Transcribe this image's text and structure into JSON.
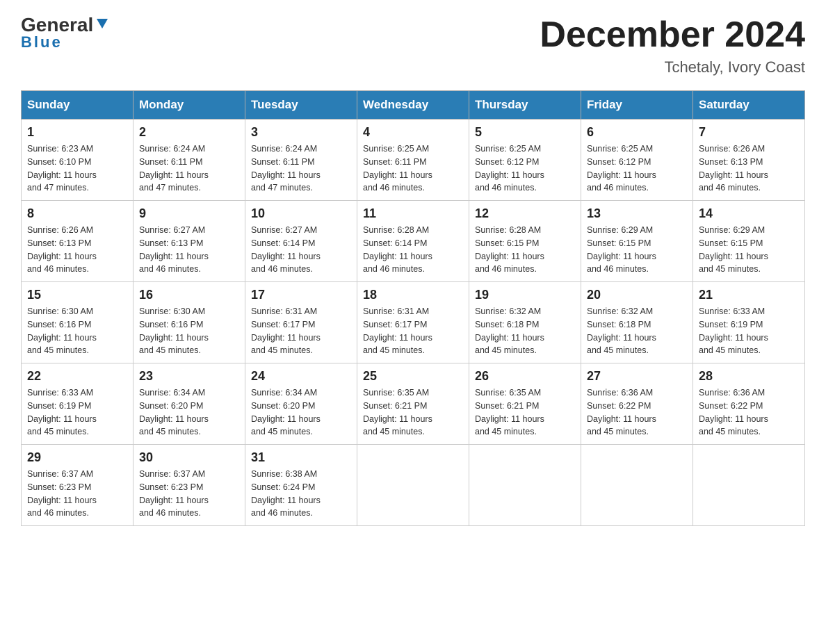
{
  "header": {
    "logo_general": "General",
    "logo_blue": "Blue",
    "month_title": "December 2024",
    "location": "Tchetaly, Ivory Coast"
  },
  "days_of_week": [
    "Sunday",
    "Monday",
    "Tuesday",
    "Wednesday",
    "Thursday",
    "Friday",
    "Saturday"
  ],
  "weeks": [
    [
      {
        "day": "1",
        "sunrise": "6:23 AM",
        "sunset": "6:10 PM",
        "daylight": "11 hours and 47 minutes."
      },
      {
        "day": "2",
        "sunrise": "6:24 AM",
        "sunset": "6:11 PM",
        "daylight": "11 hours and 47 minutes."
      },
      {
        "day": "3",
        "sunrise": "6:24 AM",
        "sunset": "6:11 PM",
        "daylight": "11 hours and 47 minutes."
      },
      {
        "day": "4",
        "sunrise": "6:25 AM",
        "sunset": "6:11 PM",
        "daylight": "11 hours and 46 minutes."
      },
      {
        "day": "5",
        "sunrise": "6:25 AM",
        "sunset": "6:12 PM",
        "daylight": "11 hours and 46 minutes."
      },
      {
        "day": "6",
        "sunrise": "6:25 AM",
        "sunset": "6:12 PM",
        "daylight": "11 hours and 46 minutes."
      },
      {
        "day": "7",
        "sunrise": "6:26 AM",
        "sunset": "6:13 PM",
        "daylight": "11 hours and 46 minutes."
      }
    ],
    [
      {
        "day": "8",
        "sunrise": "6:26 AM",
        "sunset": "6:13 PM",
        "daylight": "11 hours and 46 minutes."
      },
      {
        "day": "9",
        "sunrise": "6:27 AM",
        "sunset": "6:13 PM",
        "daylight": "11 hours and 46 minutes."
      },
      {
        "day": "10",
        "sunrise": "6:27 AM",
        "sunset": "6:14 PM",
        "daylight": "11 hours and 46 minutes."
      },
      {
        "day": "11",
        "sunrise": "6:28 AM",
        "sunset": "6:14 PM",
        "daylight": "11 hours and 46 minutes."
      },
      {
        "day": "12",
        "sunrise": "6:28 AM",
        "sunset": "6:15 PM",
        "daylight": "11 hours and 46 minutes."
      },
      {
        "day": "13",
        "sunrise": "6:29 AM",
        "sunset": "6:15 PM",
        "daylight": "11 hours and 46 minutes."
      },
      {
        "day": "14",
        "sunrise": "6:29 AM",
        "sunset": "6:15 PM",
        "daylight": "11 hours and 45 minutes."
      }
    ],
    [
      {
        "day": "15",
        "sunrise": "6:30 AM",
        "sunset": "6:16 PM",
        "daylight": "11 hours and 45 minutes."
      },
      {
        "day": "16",
        "sunrise": "6:30 AM",
        "sunset": "6:16 PM",
        "daylight": "11 hours and 45 minutes."
      },
      {
        "day": "17",
        "sunrise": "6:31 AM",
        "sunset": "6:17 PM",
        "daylight": "11 hours and 45 minutes."
      },
      {
        "day": "18",
        "sunrise": "6:31 AM",
        "sunset": "6:17 PM",
        "daylight": "11 hours and 45 minutes."
      },
      {
        "day": "19",
        "sunrise": "6:32 AM",
        "sunset": "6:18 PM",
        "daylight": "11 hours and 45 minutes."
      },
      {
        "day": "20",
        "sunrise": "6:32 AM",
        "sunset": "6:18 PM",
        "daylight": "11 hours and 45 minutes."
      },
      {
        "day": "21",
        "sunrise": "6:33 AM",
        "sunset": "6:19 PM",
        "daylight": "11 hours and 45 minutes."
      }
    ],
    [
      {
        "day": "22",
        "sunrise": "6:33 AM",
        "sunset": "6:19 PM",
        "daylight": "11 hours and 45 minutes."
      },
      {
        "day": "23",
        "sunrise": "6:34 AM",
        "sunset": "6:20 PM",
        "daylight": "11 hours and 45 minutes."
      },
      {
        "day": "24",
        "sunrise": "6:34 AM",
        "sunset": "6:20 PM",
        "daylight": "11 hours and 45 minutes."
      },
      {
        "day": "25",
        "sunrise": "6:35 AM",
        "sunset": "6:21 PM",
        "daylight": "11 hours and 45 minutes."
      },
      {
        "day": "26",
        "sunrise": "6:35 AM",
        "sunset": "6:21 PM",
        "daylight": "11 hours and 45 minutes."
      },
      {
        "day": "27",
        "sunrise": "6:36 AM",
        "sunset": "6:22 PM",
        "daylight": "11 hours and 45 minutes."
      },
      {
        "day": "28",
        "sunrise": "6:36 AM",
        "sunset": "6:22 PM",
        "daylight": "11 hours and 45 minutes."
      }
    ],
    [
      {
        "day": "29",
        "sunrise": "6:37 AM",
        "sunset": "6:23 PM",
        "daylight": "11 hours and 46 minutes."
      },
      {
        "day": "30",
        "sunrise": "6:37 AM",
        "sunset": "6:23 PM",
        "daylight": "11 hours and 46 minutes."
      },
      {
        "day": "31",
        "sunrise": "6:38 AM",
        "sunset": "6:24 PM",
        "daylight": "11 hours and 46 minutes."
      },
      null,
      null,
      null,
      null
    ]
  ],
  "cell_labels": {
    "sunrise": "Sunrise:",
    "sunset": "Sunset:",
    "daylight": "Daylight:"
  }
}
